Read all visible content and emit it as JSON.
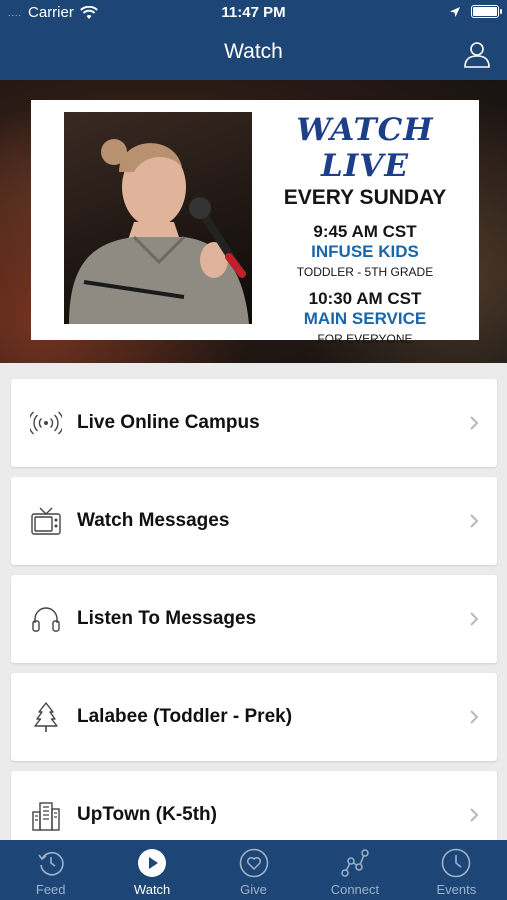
{
  "status_bar": {
    "dots": "....",
    "carrier": "Carrier",
    "time": "11:47 PM"
  },
  "header": {
    "title": "Watch"
  },
  "banner": {
    "headline": "WATCH LIVE",
    "subheadline": "EVERY SUNDAY",
    "service_1": {
      "time": "9:45 AM CST",
      "name": "INFUSE KIDS",
      "audience": "TODDLER - 5TH GRADE"
    },
    "service_2": {
      "time": "10:30 AM CST",
      "name": "MAIN SERVICE",
      "audience": "FOR EVERYONE"
    }
  },
  "menu": {
    "items": [
      {
        "label": "Live Online Campus",
        "icon": "broadcast-icon"
      },
      {
        "label": "Watch Messages",
        "icon": "tv-icon"
      },
      {
        "label": "Listen To Messages",
        "icon": "headphones-icon"
      },
      {
        "label": "Lalabee (Toddler - Prek)",
        "icon": "tree-icon"
      },
      {
        "label": "UpTown (K-5th)",
        "icon": "city-icon"
      }
    ]
  },
  "tabs": [
    {
      "label": "Feed",
      "icon": "history-icon",
      "active": false
    },
    {
      "label": "Watch",
      "icon": "play-icon",
      "active": true
    },
    {
      "label": "Give",
      "icon": "heart-icon",
      "active": false
    },
    {
      "label": "Connect",
      "icon": "connect-icon",
      "active": false
    },
    {
      "label": "Events",
      "icon": "clock-icon",
      "active": false
    }
  ],
  "colors": {
    "brand": "#1d4575",
    "accent_blue": "#1b66a8",
    "headline_blue": "#1d3f8a",
    "background": "#ebebeb"
  }
}
